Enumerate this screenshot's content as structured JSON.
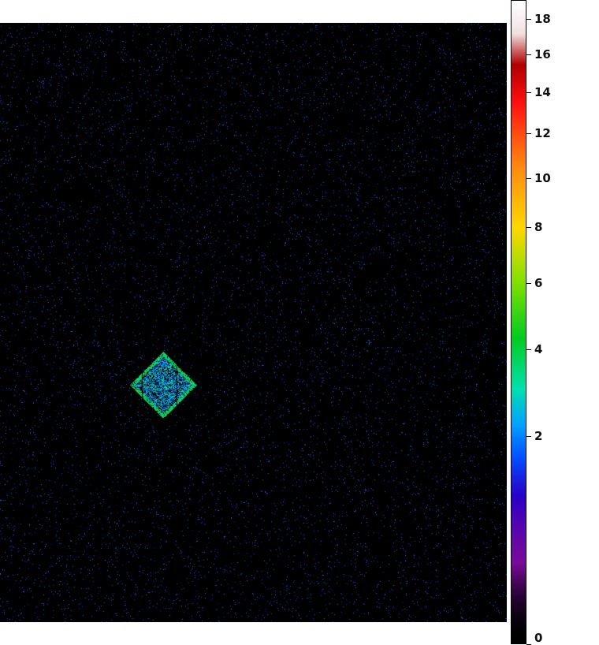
{
  "chart_data": {
    "type": "heatmap",
    "title": "",
    "description_scale": "sqrt",
    "colorbar": {
      "range": [
        0,
        19
      ],
      "ticks": [
        0,
        2,
        4,
        6,
        8,
        10,
        12,
        14,
        16,
        18
      ],
      "tick_labels": [
        "0",
        "2",
        "4",
        "6",
        "8",
        "10",
        "12",
        "14",
        "16",
        "18"
      ],
      "stops": [
        {
          "v": 0,
          "color": "#000000"
        },
        {
          "v": 0.3,
          "color": "#7a0a9a"
        },
        {
          "v": 1.0,
          "color": "#2a00c8"
        },
        {
          "v": 1.6,
          "color": "#0050ff"
        },
        {
          "v": 2.2,
          "color": "#00a0ff"
        },
        {
          "v": 3.0,
          "color": "#00e0b0"
        },
        {
          "v": 4.3,
          "color": "#00cc20"
        },
        {
          "v": 6.0,
          "color": "#80e000"
        },
        {
          "v": 8.0,
          "color": "#ffd800"
        },
        {
          "v": 10.5,
          "color": "#ff8a10"
        },
        {
          "v": 13.5,
          "color": "#ff1010"
        },
        {
          "v": 15.5,
          "color": "#b00000"
        },
        {
          "v": 17.2,
          "color": "#f0e0e0"
        },
        {
          "v": 19,
          "color": "#ffffff"
        }
      ]
    },
    "background_level": 0,
    "noise_level": 1,
    "source": {
      "shape": "diamond",
      "peak_value": 5
    }
  }
}
